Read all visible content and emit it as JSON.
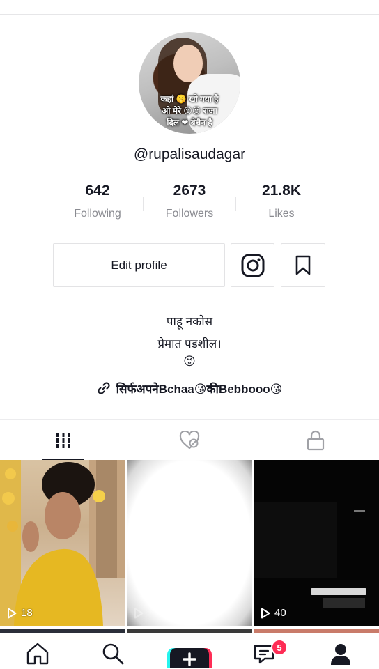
{
  "profile": {
    "avatar_overlay_text": "कहां 🤫 खो गया है\nओ मेरे 😍😍 राजा\nदिल ❤ बेचैन है",
    "username": "@rupalisaudagar",
    "stats": [
      {
        "value": "642",
        "label": "Following"
      },
      {
        "value": "2673",
        "label": "Followers"
      },
      {
        "value": "21.8K",
        "label": "Likes"
      }
    ],
    "edit_button": "Edit profile",
    "bio_lines": [
      "पाहू नकोस",
      "प्रेमात पडशील।",
      "😜"
    ],
    "link_text": "सिर्फअपनेBchaa😘कीBebbooo😘"
  },
  "tabs": {
    "active": "videos",
    "items": [
      {
        "name": "videos-grid-icon"
      },
      {
        "name": "liked-heart-icon"
      },
      {
        "name": "private-lock-icon"
      }
    ]
  },
  "videos": [
    {
      "views": "18"
    },
    {
      "views": ""
    },
    {
      "views": "40"
    }
  ],
  "nav": {
    "items": [
      "home-icon",
      "discover-search-icon",
      "create-plus-icon",
      "inbox-icon",
      "profile-icon"
    ],
    "inbox_badge": "5"
  },
  "colors": {
    "accent_red": "#fe2c55",
    "accent_cyan": "#25f4ee",
    "text": "#161823",
    "muted": "#8a8b91"
  }
}
